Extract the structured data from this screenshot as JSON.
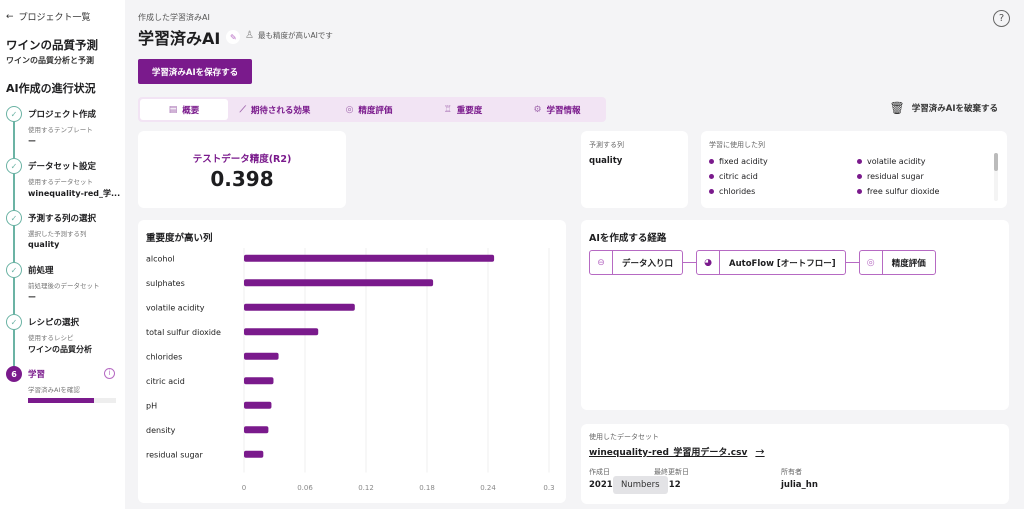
{
  "sidebar": {
    "back_label": "プロジェクト一覧",
    "project_title": "ワインの品質予測",
    "project_subtitle": "ワインの品質分析と予測",
    "progress_title": "AI作成の進行状況",
    "steps": [
      {
        "title": "プロジェクト作成",
        "label": "使用するテンプレート",
        "value": "ー",
        "status": "done"
      },
      {
        "title": "データセット設定",
        "label": "使用するデータセット",
        "value": "winequality-red_学...",
        "status": "done"
      },
      {
        "title": "予測する列の選択",
        "label": "選択した予測する列",
        "value": "quality",
        "status": "done"
      },
      {
        "title": "前処理",
        "label": "前処理後のデータセット",
        "value": "ー",
        "status": "done"
      },
      {
        "title": "レシピの選択",
        "label": "使用するレシピ",
        "value": "ワインの品質分析",
        "status": "done"
      },
      {
        "title": "学習",
        "label": "学習済みAIを確認",
        "number": "6",
        "status": "active",
        "progress": 0.75
      }
    ]
  },
  "header": {
    "breadcrumb": "作成した学習済みAI",
    "title": "学習済みAI",
    "best_badge": "最も精度が高いAIです",
    "save_button": "学習済みAIを保存する",
    "discard_button": "学習済みAIを破棄する",
    "help_icon": "?"
  },
  "tabs": [
    {
      "label": "概要",
      "icon": "document-icon",
      "active": true
    },
    {
      "label": "期待される効果",
      "icon": "line-chart-icon",
      "active": false
    },
    {
      "label": "精度評価",
      "icon": "gauge-icon",
      "active": false
    },
    {
      "label": "重要度",
      "icon": "podium-icon",
      "active": false
    },
    {
      "label": "学習情報",
      "icon": "gear-icon",
      "active": false
    }
  ],
  "accuracy": {
    "label": "テストデータ精度(R2)",
    "value": "0.398"
  },
  "predict_column": {
    "label": "予測する列",
    "value": "quality"
  },
  "training_columns": {
    "label": "学習に使用した列",
    "items": [
      "fixed acidity",
      "volatile acidity",
      "citric acid",
      "residual sugar",
      "chlorides",
      "free sulfur dioxide"
    ]
  },
  "chart_data": {
    "type": "bar",
    "orientation": "horizontal",
    "title": "重要度が高い列",
    "categories": [
      "alcohol",
      "sulphates",
      "volatile acidity",
      "total sulfur dioxide",
      "chlorides",
      "citric acid",
      "pH",
      "density",
      "residual sugar"
    ],
    "values": [
      0.246,
      0.186,
      0.109,
      0.073,
      0.034,
      0.029,
      0.027,
      0.024,
      0.019
    ],
    "xticks": [
      "0",
      "0.06",
      "0.12",
      "0.18",
      "0.24",
      "0.3"
    ],
    "xlim": [
      0,
      0.3
    ],
    "xlabel": "",
    "ylabel": "",
    "grid": true,
    "color": "#7a1a8c"
  },
  "route": {
    "title": "AIを作成する経路",
    "nodes": [
      {
        "label": "データ入り口",
        "icon": "entry-icon"
      },
      {
        "label": "AutoFlow [オートフロー]",
        "icon": "autoflow-icon"
      },
      {
        "label": "精度評価",
        "icon": "gauge-icon"
      }
    ]
  },
  "dataset": {
    "label": "使用したデータセット",
    "name": "winequality-red_学習用データ.csv",
    "created_label": "作成日",
    "created_value": "2021",
    "updated_label": "最終更新日",
    "updated_value": "09 12",
    "owner_label": "所有者",
    "owner_value": "julia_hn"
  },
  "tooltip": "Numbers",
  "colors": {
    "accent": "#7a1a8c",
    "step_done": "#6bb3a4",
    "tab_bg": "#f2e4f4"
  }
}
